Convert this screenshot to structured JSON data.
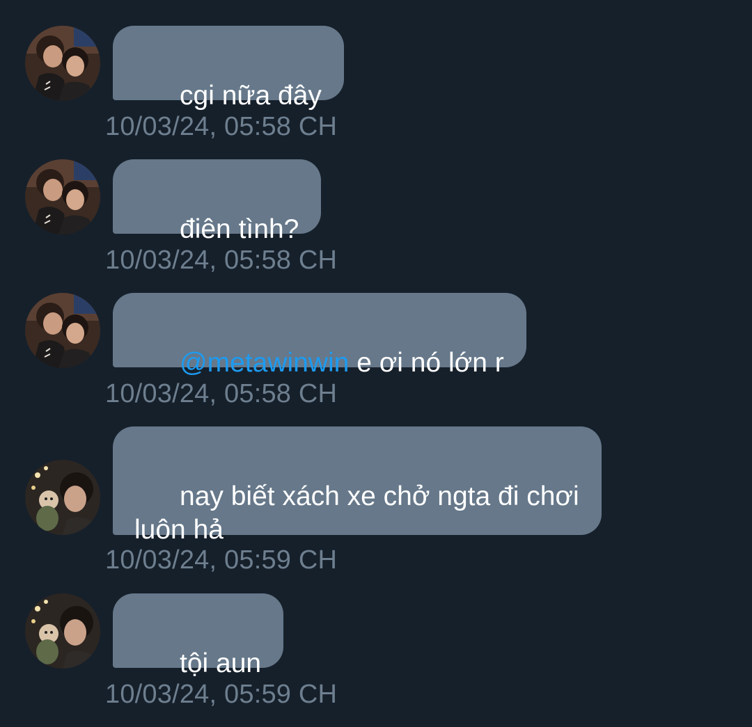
{
  "colors": {
    "background": "#16202b",
    "bubble": "#66788a",
    "bubble_text": "#ffffff",
    "mention": "#1d9bf0",
    "timestamp": "#6e7f8f"
  },
  "messages": [
    {
      "avatar_icon": "avatar-photo-couple-icon",
      "text": "cgi nữa đây",
      "timestamp": "10/03/24, 05:58 CH"
    },
    {
      "avatar_icon": "avatar-photo-couple-icon",
      "text": "điên tình?",
      "timestamp": "10/03/24, 05:58 CH"
    },
    {
      "avatar_icon": "avatar-photo-couple-icon",
      "mention": "@metawinwin",
      "text": " e ơi nó lớn r",
      "timestamp": "10/03/24, 05:58 CH"
    },
    {
      "avatar_icon": "avatar-photo-doll-icon",
      "text": "nay biết xách xe chở ngta đi chơi\nluôn hả",
      "timestamp": "10/03/24, 05:59 CH"
    },
    {
      "avatar_icon": "avatar-photo-doll-icon",
      "text": "tội aun",
      "timestamp": "10/03/24, 05:59 CH"
    }
  ]
}
